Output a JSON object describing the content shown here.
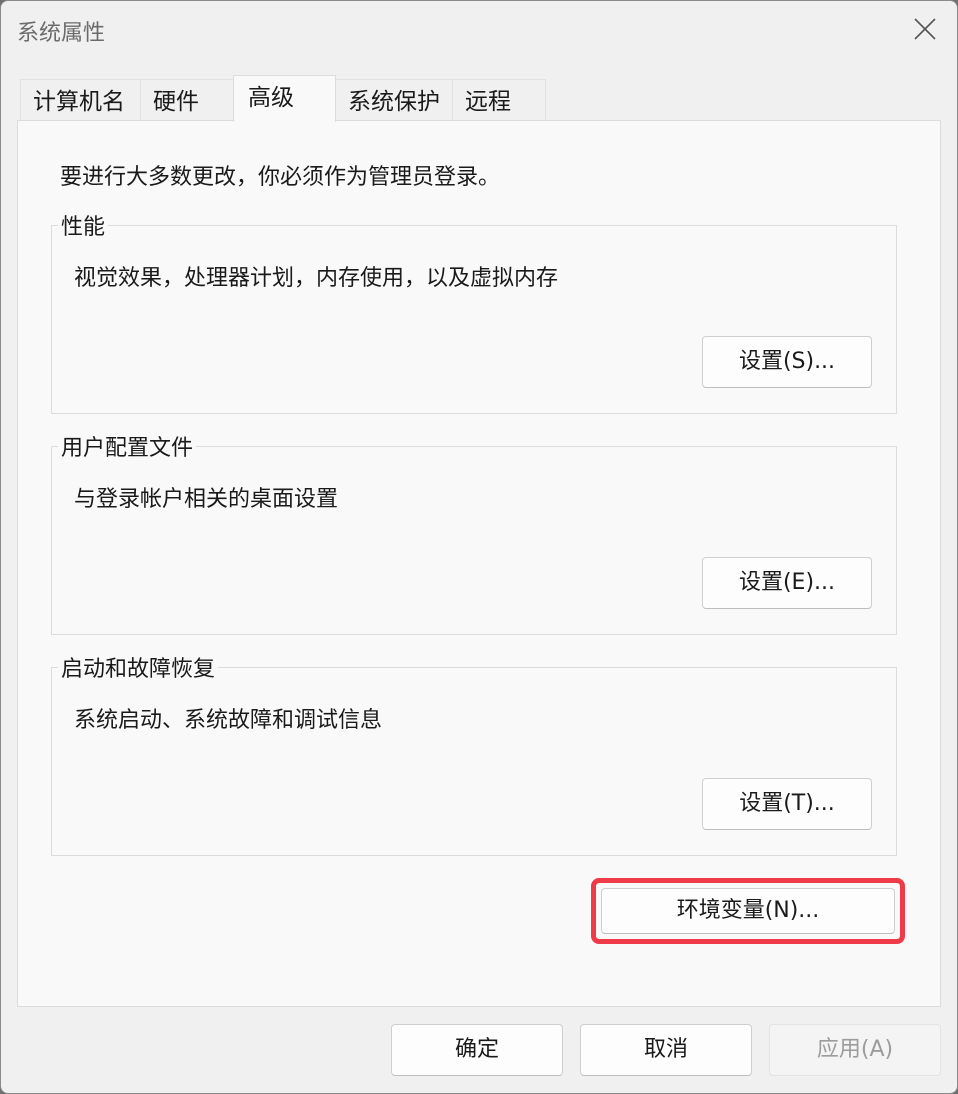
{
  "window": {
    "title": "系统属性"
  },
  "tabs": [
    {
      "label": "计算机名"
    },
    {
      "label": "硬件"
    },
    {
      "label": "高级",
      "active": true
    },
    {
      "label": "系统保护"
    },
    {
      "label": "远程"
    }
  ],
  "content": {
    "admin_note": "要进行大多数更改，你必须作为管理员登录。",
    "groups": [
      {
        "title": "性能",
        "description": "视觉效果，处理器计划，内存使用，以及虚拟内存",
        "button": "设置(S)..."
      },
      {
        "title": "用户配置文件",
        "description": "与登录帐户相关的桌面设置",
        "button": "设置(E)..."
      },
      {
        "title": "启动和故障恢复",
        "description": "系统启动、系统故障和调试信息",
        "button": "设置(T)..."
      }
    ],
    "env_button": "环境变量(N)..."
  },
  "footer": {
    "ok": "确定",
    "cancel": "取消",
    "apply": "应用(A)"
  },
  "colors": {
    "highlight": "#ef3a47",
    "panel_background": "#f9f9f9",
    "window_background": "#f0f0f0"
  },
  "icons": {
    "close": "close-icon"
  }
}
